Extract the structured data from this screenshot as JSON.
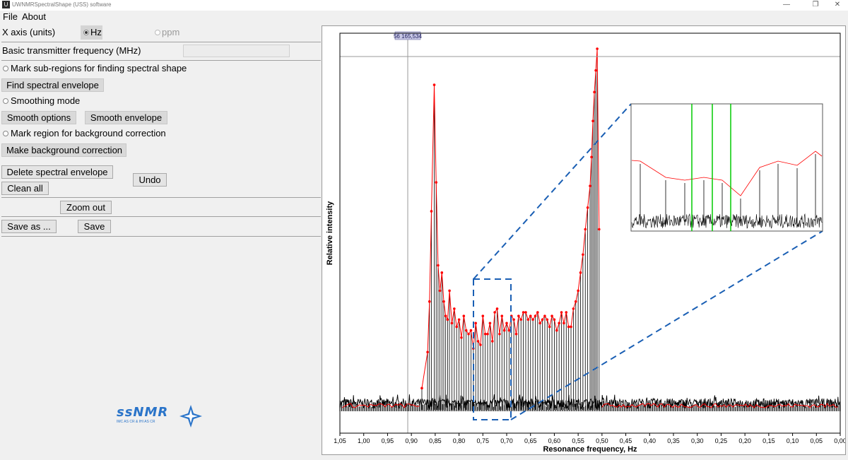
{
  "window": {
    "title": "UWNMRSpectralShape (USS) software",
    "icon_glyph": "U",
    "minimize_glyph": "—",
    "maximize_glyph": "❐",
    "close_glyph": "✕"
  },
  "menu": {
    "file": "File",
    "about": "About"
  },
  "controls": {
    "x_axis_label": "X axis  (units)",
    "hz_option": "Hz",
    "ppm_option": "ppm",
    "basic_freq_label": "Basic transmitter frequency (MHz)",
    "basic_freq_value": "",
    "mark_subregions_label": "Mark sub-regions for finding spectral shape",
    "find_envelope_button": "Find spectral envelope",
    "smoothing_mode_label": "Smoothing mode",
    "smooth_options_button": "Smooth options",
    "smooth_envelope_button": "Smooth envelope",
    "mark_background_label": "Mark region for background correction",
    "make_background_button": "Make background correction",
    "delete_envelope_button": "Delete spectral envelope",
    "undo_button": "Undo",
    "clean_all_button": "Clean all",
    "zoom_out_button": "Zoom out",
    "save_as_button": "Save as ...",
    "save_button": "Save"
  },
  "logo": {
    "main": "ssNMR",
    "sub": "IMC AS CR & IHI AS CR",
    "icon": "star-logo-icon"
  },
  "colors": {
    "envelope": "#ff0000",
    "spectrum": "#000000",
    "zoom_box": "#1a5fb4",
    "inset_markers": "#00cc00",
    "cursor_label_bg": "#c8c8e6"
  },
  "chart_data": {
    "type": "line",
    "xlabel": "Resonance frequency, Hz",
    "ylabel": "Relative intensity",
    "cursor_readout": "56 165,534",
    "x_reversed": true,
    "xlim": [
      1.05,
      0.0
    ],
    "ylim": [
      0,
      1
    ],
    "grid": false,
    "x_ticks": [
      "1,05",
      "1,00",
      "0,95",
      "0,90",
      "0,85",
      "0,80",
      "0,75",
      "0,70",
      "0,65",
      "0,60",
      "0,55",
      "0,50",
      "0,45",
      "0,40",
      "0,35",
      "0,30",
      "0,25",
      "0,20",
      "0,15",
      "0,10",
      "0,05",
      "0,00"
    ],
    "x_tick_values": [
      1.05,
      1.0,
      0.95,
      0.9,
      0.85,
      0.8,
      0.75,
      0.7,
      0.65,
      0.6,
      0.55,
      0.5,
      0.45,
      0.4,
      0.35,
      0.3,
      0.25,
      0.2,
      0.15,
      0.1,
      0.05,
      0.0
    ],
    "series": [
      {
        "name": "Spectral envelope",
        "style": "red line with dot markers",
        "x": [
          0.878,
          0.866,
          0.862,
          0.858,
          0.852,
          0.848,
          0.844,
          0.84,
          0.836,
          0.832,
          0.828,
          0.824,
          0.82,
          0.815,
          0.81,
          0.805,
          0.8,
          0.795,
          0.79,
          0.785,
          0.78,
          0.775,
          0.77,
          0.765,
          0.76,
          0.755,
          0.75,
          0.745,
          0.74,
          0.735,
          0.73,
          0.725,
          0.72,
          0.715,
          0.71,
          0.705,
          0.7,
          0.695,
          0.69,
          0.685,
          0.68,
          0.675,
          0.67,
          0.665,
          0.66,
          0.655,
          0.65,
          0.645,
          0.64,
          0.635,
          0.63,
          0.625,
          0.62,
          0.615,
          0.61,
          0.605,
          0.6,
          0.595,
          0.59,
          0.585,
          0.58,
          0.575,
          0.57,
          0.565,
          0.56,
          0.555,
          0.55,
          0.545,
          0.54,
          0.535,
          0.53,
          0.525,
          0.522,
          0.519,
          0.516,
          0.513,
          0.51,
          0.506
        ],
        "y": [
          0.06,
          0.16,
          0.3,
          0.55,
          0.9,
          0.63,
          0.4,
          0.33,
          0.38,
          0.3,
          0.26,
          0.25,
          0.33,
          0.24,
          0.28,
          0.23,
          0.25,
          0.2,
          0.26,
          0.22,
          0.21,
          0.22,
          0.17,
          0.24,
          0.19,
          0.18,
          0.26,
          0.21,
          0.21,
          0.24,
          0.19,
          0.27,
          0.28,
          0.21,
          0.26,
          0.22,
          0.24,
          0.22,
          0.26,
          0.25,
          0.21,
          0.26,
          0.25,
          0.27,
          0.27,
          0.25,
          0.26,
          0.25,
          0.26,
          0.27,
          0.24,
          0.25,
          0.26,
          0.25,
          0.23,
          0.26,
          0.25,
          0.22,
          0.24,
          0.27,
          0.24,
          0.27,
          0.23,
          0.23,
          0.28,
          0.3,
          0.33,
          0.38,
          0.43,
          0.5,
          0.56,
          0.62,
          0.7,
          0.8,
          0.88,
          0.94,
          1.0,
          0.5
        ]
      }
    ],
    "annotations": [
      "zoom box around 0.78–0.70 Hz",
      "inset magnification of envelope and peaks with three green marker lines"
    ]
  }
}
